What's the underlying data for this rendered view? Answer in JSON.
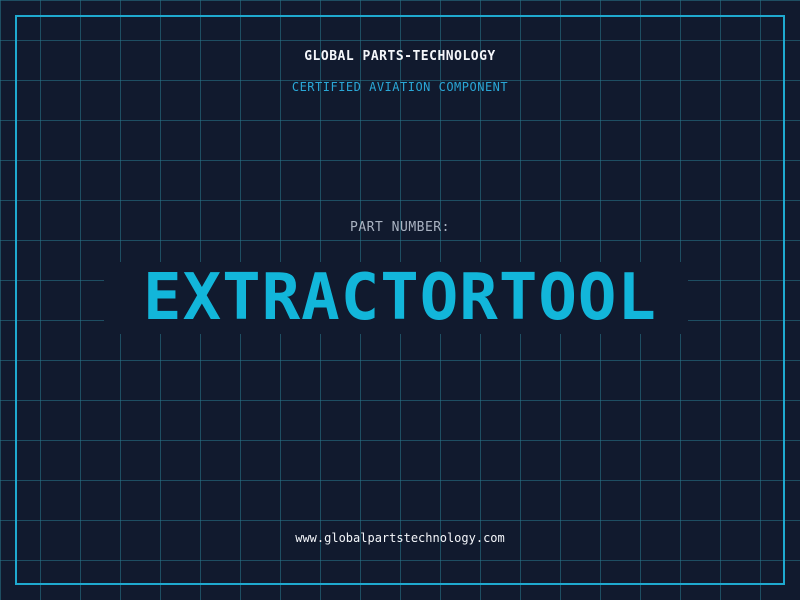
{
  "label": {
    "company": "GLOBAL PARTS-TECHNOLOGY",
    "subtitle": "CERTIFIED AVIATION COMPONENT",
    "part_label": "PART NUMBER:",
    "part_number": "EXTRACTORTOOL",
    "website": "www.globalpartstechnology.com"
  },
  "colors": {
    "background": "#111a2e",
    "grid": "#28788c",
    "frame": "#1fa9cf",
    "accent": "#12b6da",
    "text": "#f4f6fa",
    "muted": "#aab3c2"
  }
}
